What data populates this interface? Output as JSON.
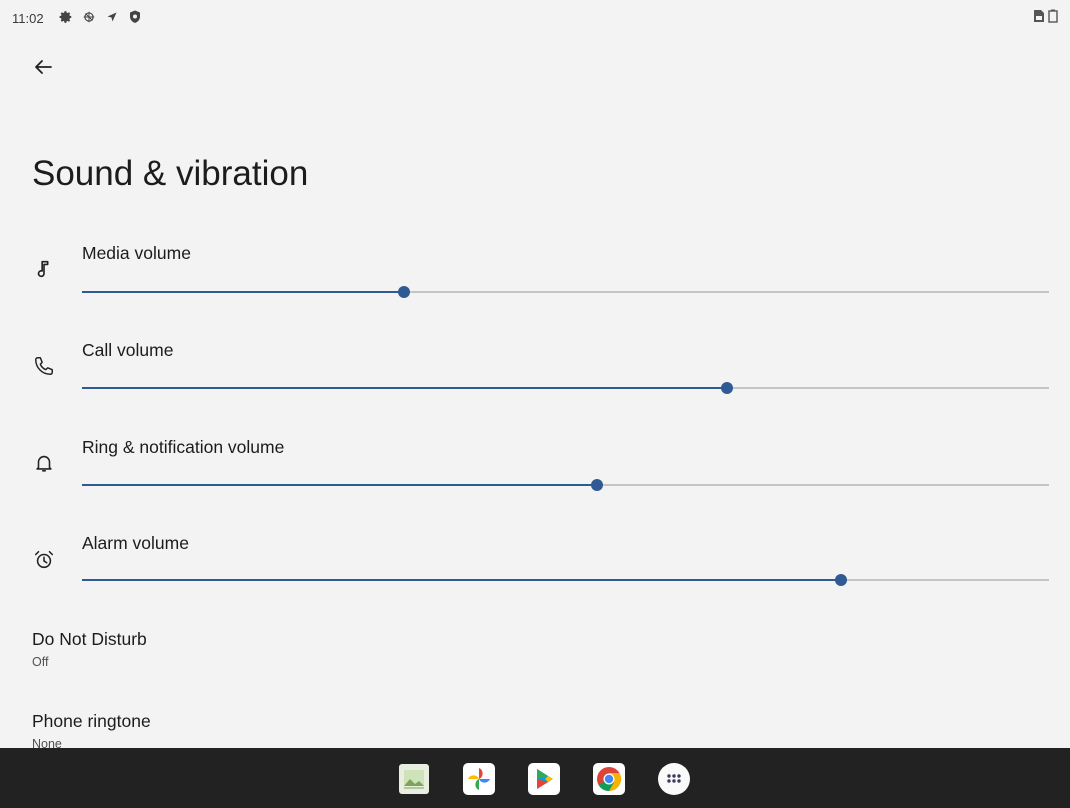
{
  "status_bar": {
    "time": "11:02",
    "left_icons": [
      "settings-gear-icon",
      "debug-icon",
      "location-arrow-icon",
      "shield-icon"
    ],
    "right_icons": [
      "sim-icon",
      "battery-icon"
    ]
  },
  "header": {
    "back_icon": "arrow-back-icon",
    "title": "Sound & vibration"
  },
  "volume_sliders": [
    {
      "label": "Media volume",
      "icon": "music-note-icon",
      "level": 0.333
    },
    {
      "label": "Call volume",
      "icon": "phone-icon",
      "level": 0.667
    },
    {
      "label": "Ring & notification volume",
      "icon": "bell-icon",
      "level": 0.533
    },
    {
      "label": "Alarm volume",
      "icon": "alarm-clock-icon",
      "level": 0.785
    }
  ],
  "preferences": [
    {
      "title": "Do Not Disturb",
      "summary": "Off"
    },
    {
      "title": "Phone ringtone",
      "summary": "None"
    }
  ],
  "taskbar": {
    "apps": [
      "gallery-app-icon",
      "photos-app-icon",
      "play-store-app-icon",
      "chrome-app-icon",
      "all-apps-icon"
    ]
  },
  "colors": {
    "accent": "#2f5a93",
    "track": "#c4c4c4",
    "background": "#f3f3f3",
    "taskbar": "#222223"
  }
}
